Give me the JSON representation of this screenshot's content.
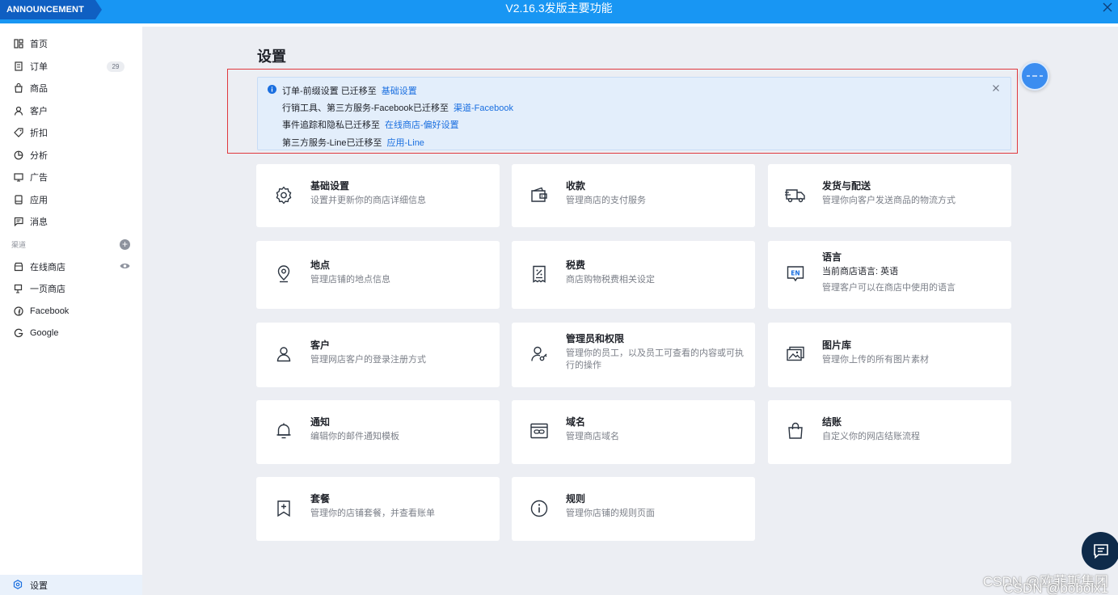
{
  "topbar": {
    "tag": "ANNOUNCEMENT",
    "title": "V2.16.3发版主要功能"
  },
  "sidebar": {
    "items": [
      {
        "label": "首页",
        "icon": "dashboard-icon"
      },
      {
        "label": "订单",
        "icon": "order-icon",
        "badge": "29"
      },
      {
        "label": "商品",
        "icon": "product-icon"
      },
      {
        "label": "客户",
        "icon": "customer-icon"
      },
      {
        "label": "折扣",
        "icon": "tag-icon"
      },
      {
        "label": "分析",
        "icon": "analytics-icon"
      },
      {
        "label": "广告",
        "icon": "ad-icon"
      },
      {
        "label": "应用",
        "icon": "apps-icon"
      },
      {
        "label": "消息",
        "icon": "message-icon"
      }
    ],
    "channels_label": "渠道",
    "channels": [
      {
        "label": "在线商店",
        "icon": "store-icon"
      },
      {
        "label": "一页商店",
        "icon": "one-page-store-icon"
      },
      {
        "label": "Facebook",
        "icon": "facebook-icon"
      },
      {
        "label": "Google",
        "icon": "google-icon"
      }
    ],
    "settings": "设置"
  },
  "main": {
    "title": "设置",
    "notice": [
      {
        "text": "订单-前缀设置 已迁移至",
        "link": "基础设置"
      },
      {
        "text": "行销工具、第三方服务-Facebook已迁移至",
        "link": "渠道-Facebook"
      },
      {
        "text": "事件追踪和隐私已迁移至",
        "link": "在线商店-偏好设置"
      },
      {
        "text": "第三方服务-Line已迁移至",
        "link": "应用-Line"
      }
    ],
    "cards": [
      {
        "title": "基础设置",
        "desc": "设置并更新你的商店详细信息"
      },
      {
        "title": "收款",
        "desc": "管理商店的支付服务"
      },
      {
        "title": "发货与配送",
        "desc": "管理你向客户发送商品的物流方式"
      },
      {
        "title": "地点",
        "desc": "管理店铺的地点信息"
      },
      {
        "title": "税费",
        "desc": "商店购物税费相关设定"
      },
      {
        "title": "语言",
        "desc": "当前商店语言: 英语",
        "desc2": "管理客户可以在商店中使用的语言"
      },
      {
        "title": "客户",
        "desc": "管理网店客户的登录注册方式"
      },
      {
        "title": "管理员和权限",
        "desc": "管理你的员工，以及员工可查看的内容或可执行的操作"
      },
      {
        "title": "图片库",
        "desc": "管理你上传的所有图片素材"
      },
      {
        "title": "通知",
        "desc": "编辑你的邮件通知模板"
      },
      {
        "title": "域名",
        "desc": "管理商店域名"
      },
      {
        "title": "结账",
        "desc": "自定义你的网店结账流程"
      },
      {
        "title": "套餐",
        "desc": "管理你的店铺套餐，并查看账单"
      },
      {
        "title": "规则",
        "desc": "管理你店铺的规则页面"
      }
    ]
  },
  "watermark": {
    "line1": "CSDN @欧菲斯集团",
    "line2": "CSDN @bobolx1"
  },
  "colors": {
    "accent": "#1896f3",
    "link": "#1a6fe0",
    "highlight_border": "#e0383d"
  }
}
